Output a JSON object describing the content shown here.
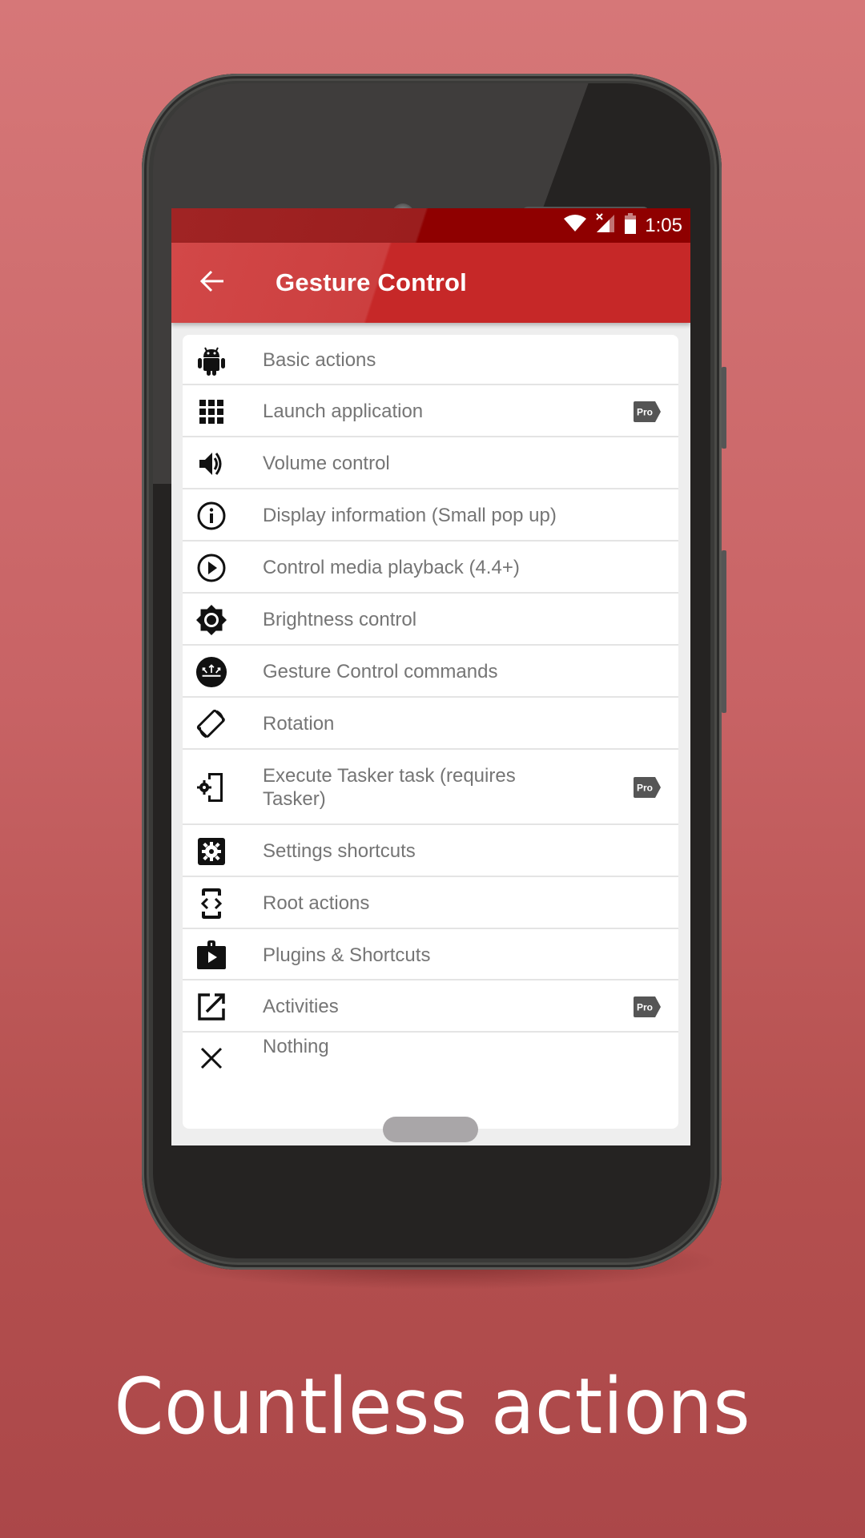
{
  "status_bar": {
    "time": "1:05",
    "icons": [
      "wifi-icon",
      "signal-no-data-icon",
      "battery-icon"
    ]
  },
  "toolbar": {
    "back_icon": "arrow-back-icon",
    "title": "Gesture Control"
  },
  "actions": [
    {
      "label": "Basic actions",
      "icon": "android-icon",
      "pro": false
    },
    {
      "label": "Launch application",
      "icon": "apps-grid-icon",
      "pro": true
    },
    {
      "label": "Volume control",
      "icon": "volume-icon",
      "pro": false
    },
    {
      "label": "Display information (Small pop up)",
      "icon": "info-icon",
      "pro": false
    },
    {
      "label": "Control media playback (4.4+)",
      "icon": "play-circle-icon",
      "pro": false
    },
    {
      "label": "Brightness control",
      "icon": "brightness-icon",
      "pro": false
    },
    {
      "label": "Gesture Control commands",
      "icon": "gesture-commands-icon",
      "pro": false
    },
    {
      "label": "Rotation",
      "icon": "screen-rotation-icon",
      "pro": false
    },
    {
      "label": "Execute Tasker task (requires Tasker)",
      "icon": "tasker-settings-phone-icon",
      "pro": true
    },
    {
      "label": "Settings shortcuts",
      "icon": "settings-box-icon",
      "pro": false
    },
    {
      "label": "Root actions",
      "icon": "developer-mode-icon",
      "pro": false
    },
    {
      "label": "Plugins & Shortcuts",
      "icon": "shop-bag-play-icon",
      "pro": false
    },
    {
      "label": "Activities",
      "icon": "open-external-icon",
      "pro": true
    },
    {
      "label": "Nothing",
      "icon": "close-icon",
      "pro": false
    }
  ],
  "pro_badge": "Pro",
  "caption": "Countless actions",
  "colors": {
    "toolbar": "#C62828",
    "status_bar": "#8F0000",
    "label_text": "#757575",
    "pro_badge": "#555555",
    "background_top": "#D67778",
    "background_bottom": "#AB4749"
  }
}
